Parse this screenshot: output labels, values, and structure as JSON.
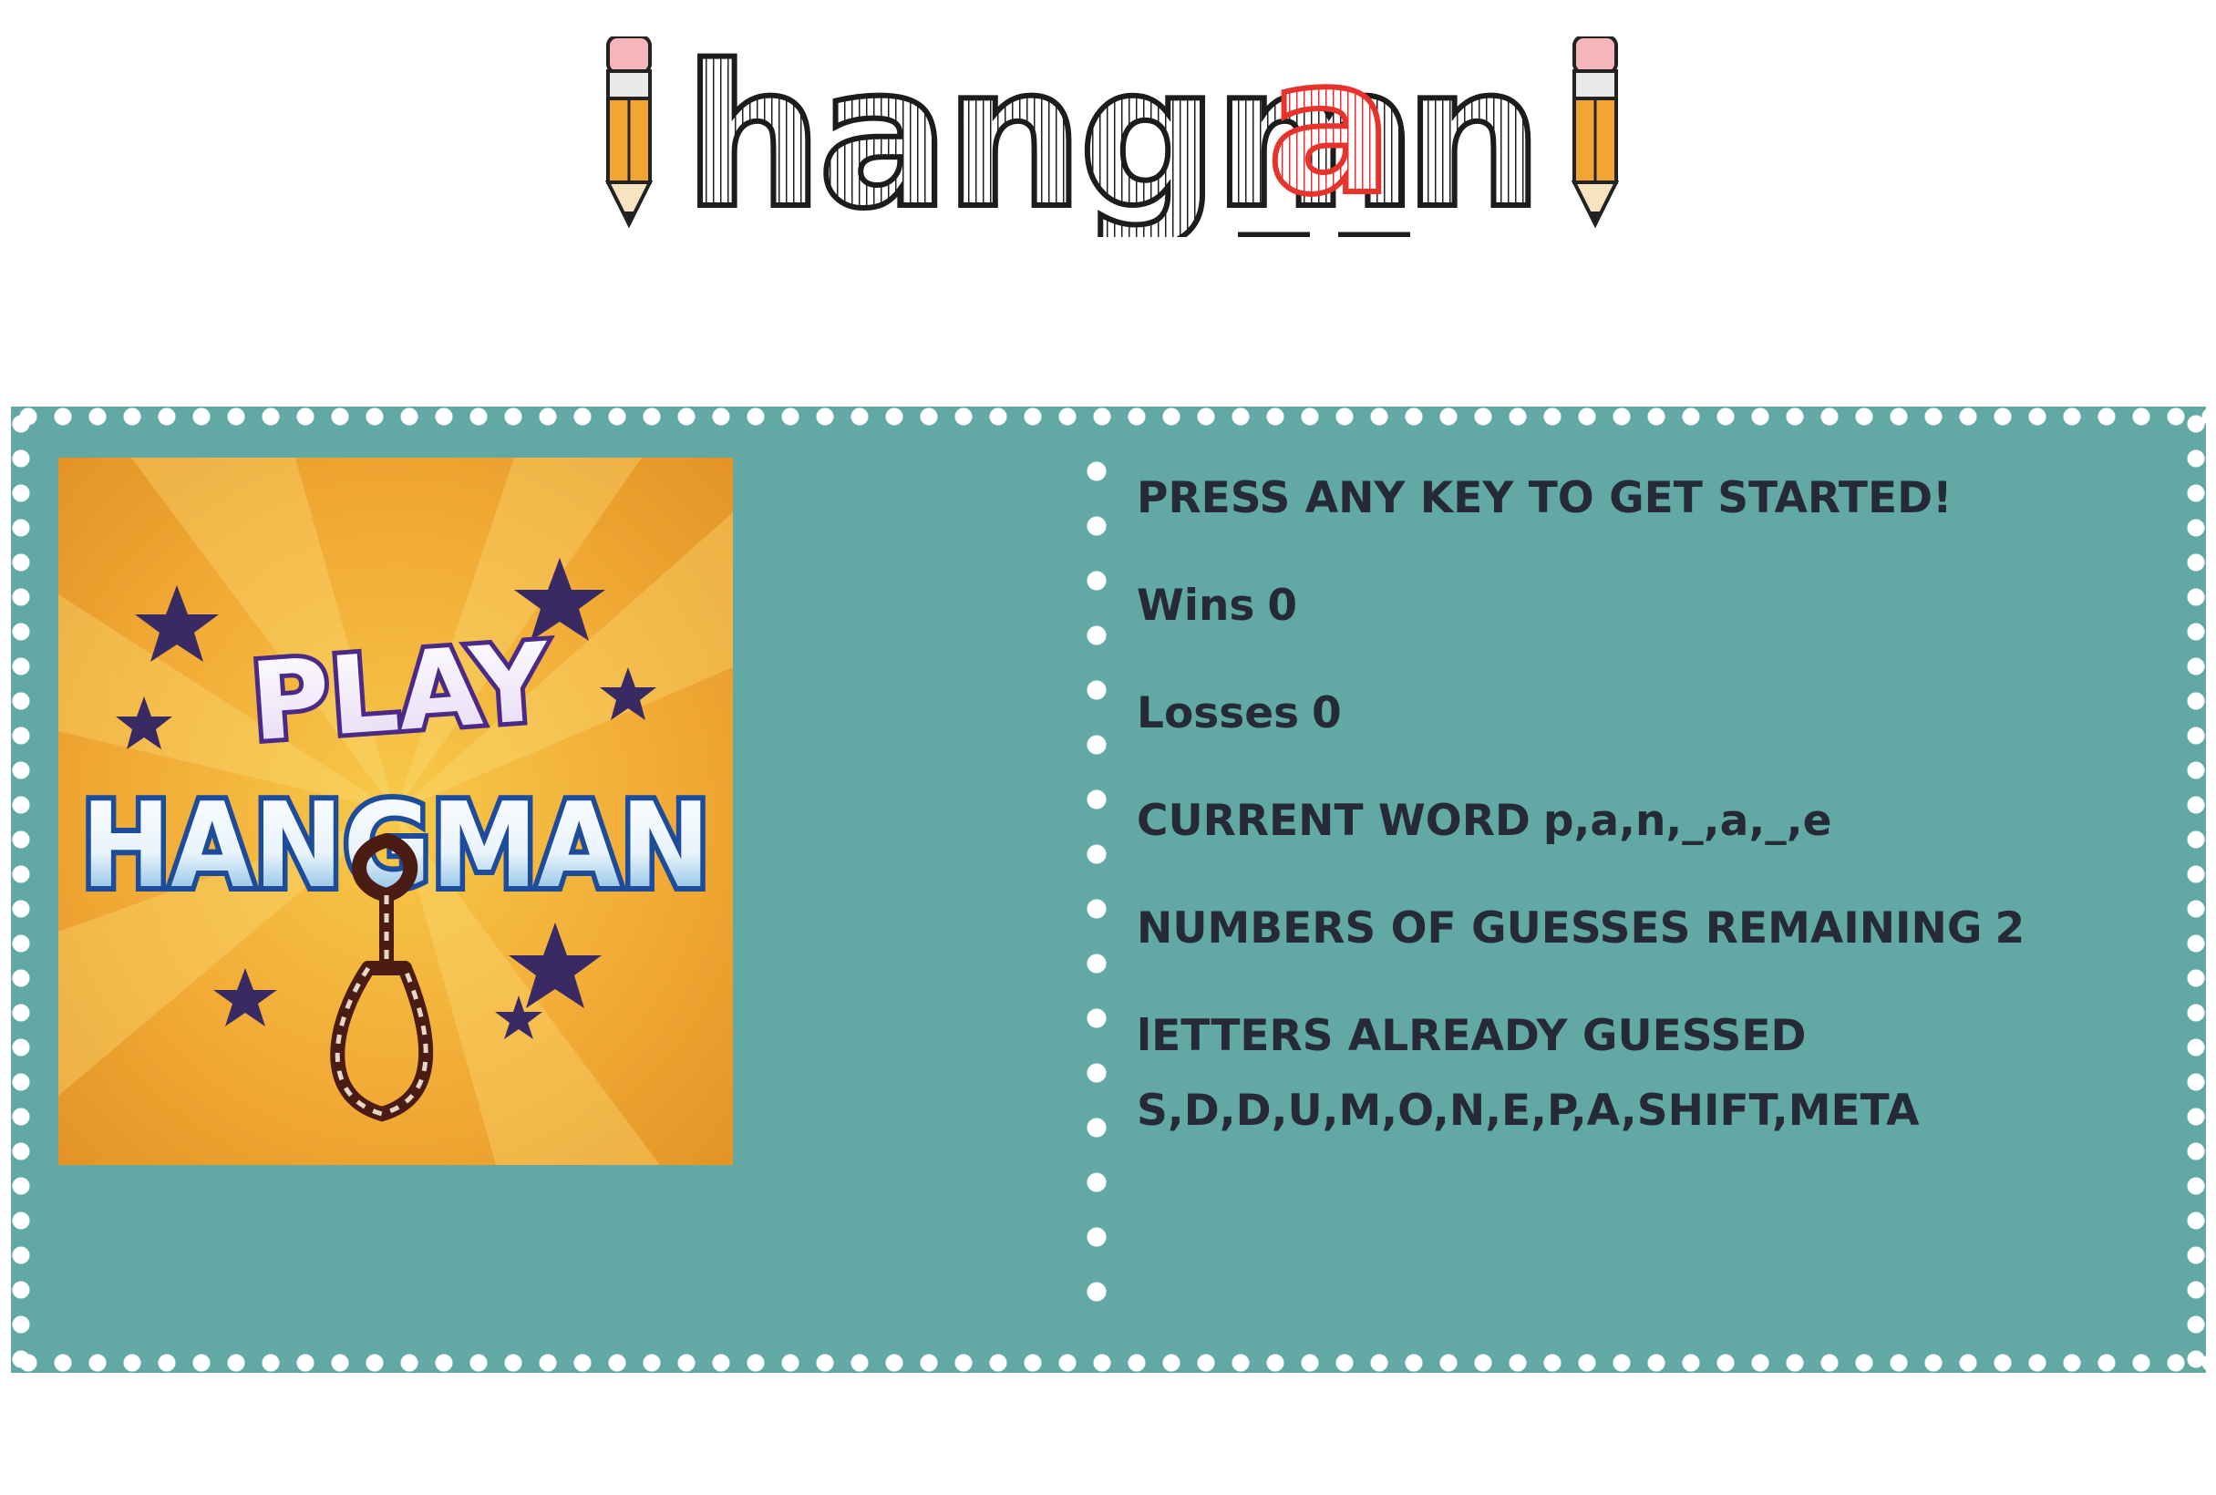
{
  "logo": {
    "text_part1": "hangm",
    "underscore1": "_",
    "accent_letter": "a",
    "underscore2": "_",
    "text_part2": "n",
    "accent_color": "#e8322c"
  },
  "art": {
    "line1": "PLAY",
    "line2": "HANGMAN"
  },
  "status": {
    "prompt": "PRESS ANY KEY TO GET STARTED!",
    "wins_label": "Wins",
    "wins_value": "0",
    "losses_label": "Losses",
    "losses_value": "0",
    "current_word_label": "CURRENT WORD",
    "current_word_value": "p,a,n,_,a,_,e",
    "guesses_label": "NUMBERS OF GUESSES REMAINING",
    "guesses_value": "2",
    "letters_label": "lETTERS ALREADY GUESSED",
    "letters_value": "S,D,D,U,M,O,N,E,P,A,SHIFT,META"
  },
  "colors": {
    "panel": "#62a8a4",
    "text": "#262a36",
    "dots": "#ffffff"
  },
  "icons": [
    "pencil-icon",
    "noose-icon",
    "star-icon"
  ]
}
